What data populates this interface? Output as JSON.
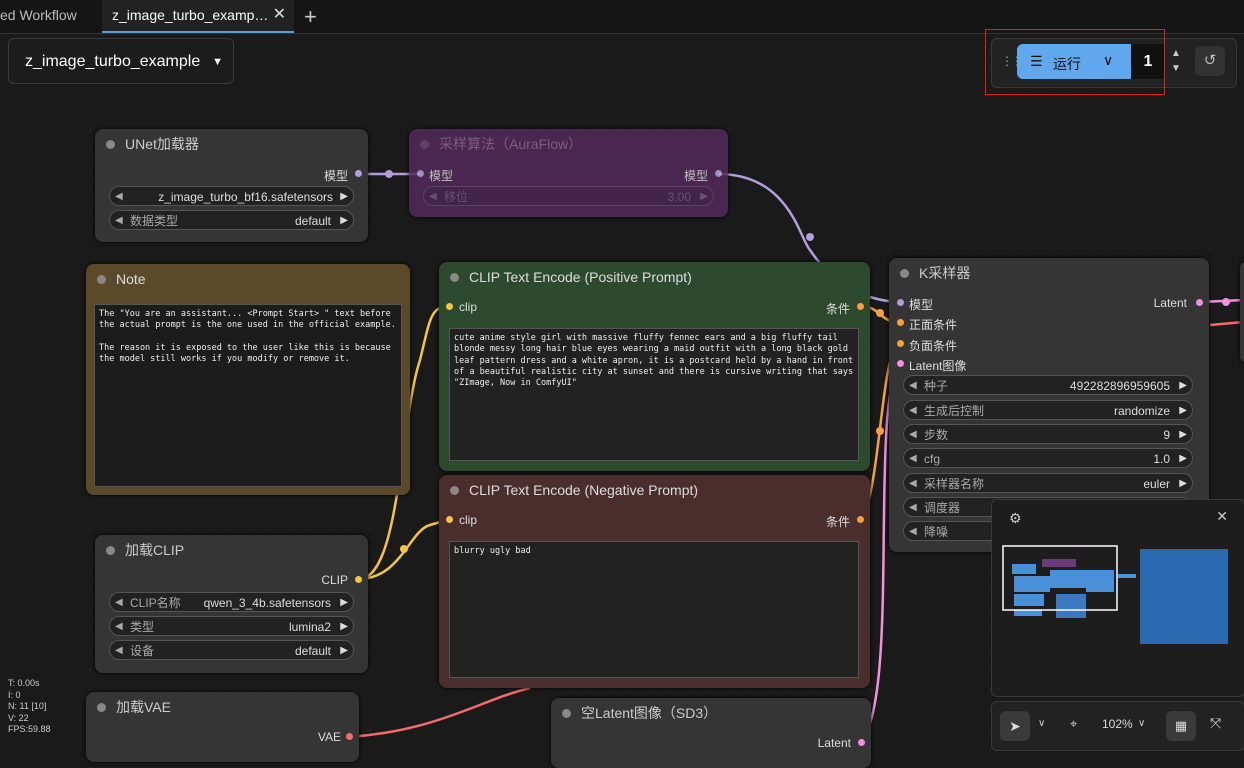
{
  "tabs": [
    {
      "label": "ed Workflow"
    },
    {
      "label": "z_image_turbo_examp…"
    }
  ],
  "new_tab_icon": "plus-icon",
  "workflow_name": "z_image_turbo_example",
  "run": {
    "label": "运行",
    "count": "1"
  },
  "nodes": {
    "unet": {
      "title": "UNet加载器",
      "out": "模型",
      "w1_value": "z_image_turbo_bf16.safetensors",
      "w2_name": "数据类型",
      "w2_value": "default"
    },
    "aura": {
      "title": "采样算法（AuraFlow）",
      "in": "模型",
      "out": "模型",
      "w1_name": "移位",
      "w1_value": "3.00"
    },
    "note": {
      "title": "Note",
      "text": "The \"You are an assistant... <Prompt Start> \" text before\nthe actual prompt is the one used in the official example.\n\nThe reason it is exposed to the user like this is because\nthe model still works if you modify or remove it."
    },
    "pos": {
      "title": "CLIP Text Encode (Positive Prompt)",
      "in": "clip",
      "out": "条件",
      "text": "cute anime style girl with massive fluffy fennec ears and a big fluffy tail blonde messy long hair blue eyes wearing a maid outfit with a long black gold leaf pattern dress and a white apron, it is a postcard held by a hand in front of a beautiful realistic city at sunset and there is cursive writing that says \"ZImage, Now in ComfyUI\""
    },
    "neg": {
      "title": "CLIP Text Encode (Negative Prompt)",
      "in": "clip",
      "out": "条件",
      "text": "blurry ugly bad"
    },
    "ksampler": {
      "title": "K采样器",
      "in1": "模型",
      "in2": "正面条件",
      "in3": "负面条件",
      "in4": "Latent图像",
      "out": "Latent",
      "seed_name": "种子",
      "seed": "492282896959605",
      "ctrl_name": "生成后控制",
      "ctrl": "randomize",
      "steps_name": "步数",
      "steps": "9",
      "cfg_name": "cfg",
      "cfg": "1.0",
      "sampler_name": "采样器名称",
      "sampler": "euler",
      "sched_name": "调度器",
      "denoise_name": "降噪"
    },
    "clip": {
      "title": "加载CLIP",
      "out": "CLIP",
      "w1_name": "CLIP名称",
      "w1_value": "qwen_3_4b.safetensors",
      "w2_name": "类型",
      "w2_value": "lumina2",
      "w3_name": "设备",
      "w3_value": "default"
    },
    "vae": {
      "title": "加载VAE",
      "out": "VAE"
    },
    "latent": {
      "title": "空Latent图像（SD3）",
      "out": "Latent"
    }
  },
  "stats": {
    "t": "T: 0.00s",
    "i": "I: 0",
    "n": "N: 11 [10]",
    "v": "V: 22",
    "fps": "FPS:59.88"
  },
  "zoom": "102%",
  "colors": {
    "accent": "#5fa8ee",
    "clip_link": "#f5c542",
    "cond_link": "#f5a142",
    "model_link": "#b39ddb",
    "latent_link": "#f48fe0",
    "vae_link": "#f56a6a"
  }
}
